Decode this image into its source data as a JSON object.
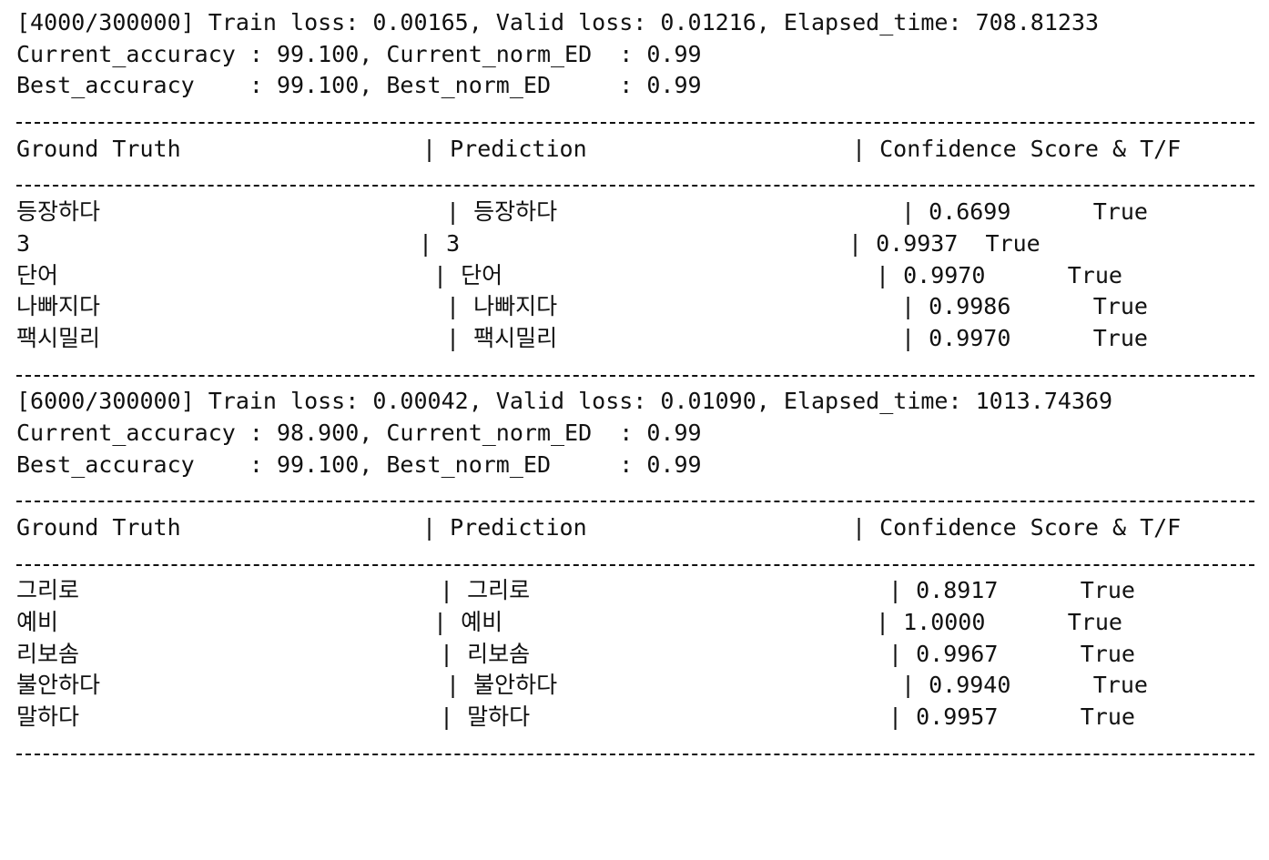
{
  "blocks": [
    {
      "status_line": "[4000/300000] Train loss: 0.00165, Valid loss: 0.01216, Elapsed_time: 708.81233",
      "current_line": "Current_accuracy : 99.100, Current_norm_ED  : 0.99",
      "best_line": "Best_accuracy    : 99.100, Best_norm_ED     : 0.99",
      "header": {
        "ground_truth": "Ground Truth",
        "prediction": "| Prediction",
        "confidence": "| Confidence Score & T/F"
      },
      "rows": [
        {
          "ground_truth": "등장하다",
          "prediction": "| 등장하다",
          "confidence": "| 0.6699      True"
        },
        {
          "ground_truth": "3",
          "prediction": "| 3",
          "confidence": "| 0.9937  True"
        },
        {
          "ground_truth": "단어",
          "prediction": "| 단어",
          "confidence": "| 0.9970      True"
        },
        {
          "ground_truth": "나빠지다",
          "prediction": "| 나빠지다",
          "confidence": "| 0.9986      True"
        },
        {
          "ground_truth": "팩시밀리",
          "prediction": "| 팩시밀리",
          "confidence": "| 0.9970      True"
        }
      ]
    },
    {
      "status_line": "[6000/300000] Train loss: 0.00042, Valid loss: 0.01090, Elapsed_time: 1013.74369",
      "current_line": "Current_accuracy : 98.900, Current_norm_ED  : 0.99",
      "best_line": "Best_accuracy    : 99.100, Best_norm_ED     : 0.99",
      "header": {
        "ground_truth": "Ground Truth",
        "prediction": "| Prediction",
        "confidence": "| Confidence Score & T/F"
      },
      "rows": [
        {
          "ground_truth": "그리로",
          "prediction": "| 그리로",
          "confidence": "| 0.8917      True"
        },
        {
          "ground_truth": "예비",
          "prediction": "| 예비",
          "confidence": "| 1.0000      True"
        },
        {
          "ground_truth": "리보솜",
          "prediction": "| 리보솜",
          "confidence": "| 0.9967      True"
        },
        {
          "ground_truth": "불안하다",
          "prediction": "| 불안하다",
          "confidence": "| 0.9940      True"
        },
        {
          "ground_truth": "말하다",
          "prediction": "| 말하다",
          "confidence": "| 0.9957      True"
        }
      ]
    }
  ]
}
